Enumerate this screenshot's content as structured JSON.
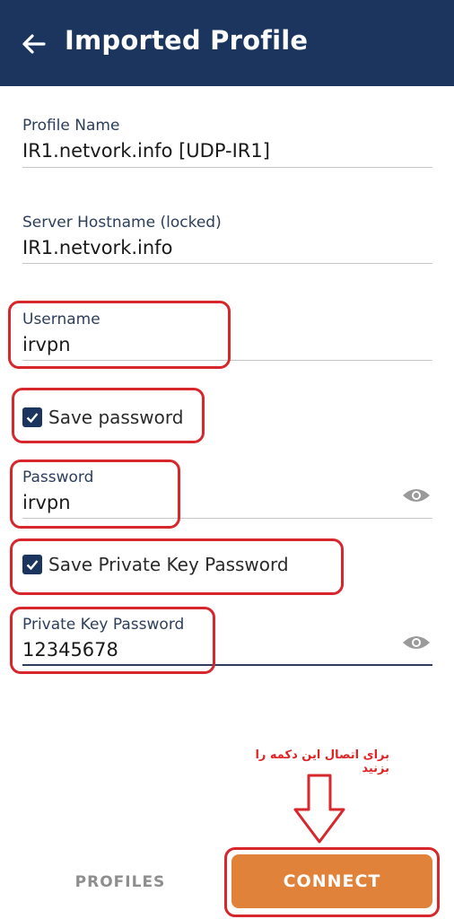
{
  "appbar": {
    "title": "Imported Profile",
    "back_icon": "arrow-left-icon",
    "background": "#1c355e"
  },
  "fields": {
    "profile_name": {
      "label": "Profile Name",
      "value": "IR1.netvork.info [UDP-IR1]"
    },
    "server_hostname": {
      "label": "Server Hostname (locked)",
      "value": "IR1.netvork.info"
    },
    "username": {
      "label": "Username",
      "value": "irvpn"
    },
    "password": {
      "label": "Password",
      "value": "irvpn",
      "icon": "eye-icon"
    },
    "private_key_password": {
      "label": "Private Key Password",
      "value": "12345678",
      "icon": "eye-icon"
    }
  },
  "checkboxes": {
    "save_password": {
      "label": "Save password",
      "checked": true
    },
    "save_private_key_password": {
      "label": "Save Private Key Password",
      "checked": true
    }
  },
  "annotation": {
    "note": "برای اتصال این دکمه را بزنید",
    "color": "#d7262c",
    "arrow_icon": "down-arrow-outline-icon"
  },
  "footer": {
    "profiles_label": "PROFILES",
    "connect_label": "CONNECT",
    "connect_color": "#e0823a"
  }
}
